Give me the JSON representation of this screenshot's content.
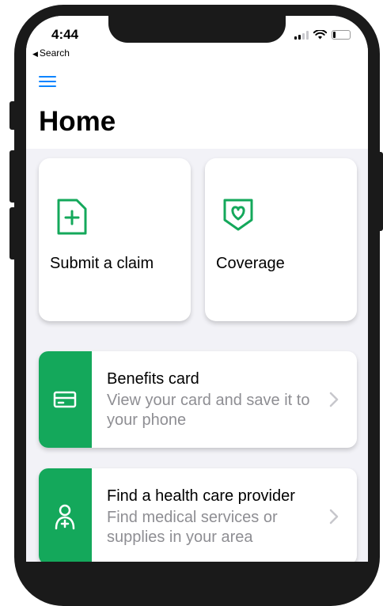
{
  "status_bar": {
    "time": "4:44",
    "back_label": "Search"
  },
  "header": {
    "title": "Home"
  },
  "tiles": [
    {
      "label": "Submit a claim",
      "icon": "file-plus-icon"
    },
    {
      "label": "Coverage",
      "icon": "shield-heart-icon"
    }
  ],
  "cards": [
    {
      "title": "Benefits card",
      "subtitle": "View your card and save it to your phone",
      "icon": "card-icon"
    },
    {
      "title": "Find a health care provider",
      "subtitle": "Find medical services or supplies in your area",
      "icon": "provider-icon"
    }
  ],
  "colors": {
    "accent_green": "#14a85b",
    "link_blue": "#0a84ff",
    "subtitle_gray": "#8e8e93"
  }
}
